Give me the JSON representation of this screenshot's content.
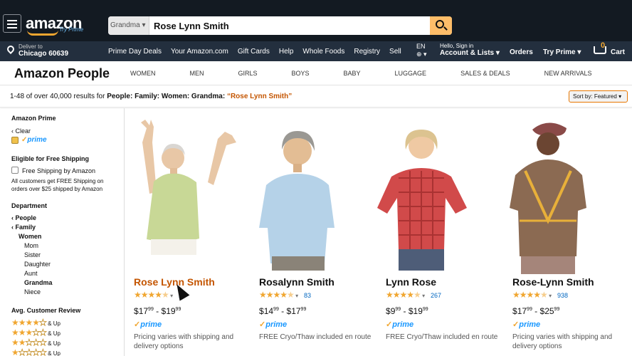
{
  "header": {
    "logo_text": "amazon",
    "logo_subtext": "Try Prime",
    "search_category": "Grandma",
    "search_value": "Rose Lynn Smith",
    "deliver_line1": "Deliver to",
    "deliver_line2": "Chicago 60639",
    "sublinks": [
      "Prime Day Deals",
      "Your Amazon.com",
      "Gift Cards",
      "Help",
      "Whole Foods",
      "Registry",
      "Sell"
    ],
    "lang": "EN",
    "account_line1": "Hello, Sign in",
    "account_line2": "Account & Lists",
    "orders": "Orders",
    "try_prime": "Try Prime",
    "cart_count": "0",
    "cart_label": "Cart"
  },
  "store": {
    "title": "Amazon People",
    "categories": [
      "WOMEN",
      "MEN",
      "GIRLS",
      "BOYS",
      "BABY",
      "LUGGAGE",
      "SALES & DEALS",
      "NEW ARRIVALS"
    ]
  },
  "results": {
    "prefix": "1-48 of over 40,000 results for",
    "path": "People: Family: Women: Grandma:",
    "query": "“Rose Lynn Smith”",
    "sort_label": "Sort by:",
    "sort_value": "Featured"
  },
  "sidebar": {
    "prime_heading": "Amazon Prime",
    "clear": "Clear",
    "prime_text": "prime",
    "shipping_heading": "Eligible for Free Shipping",
    "free_shipping": "Free Shipping by Amazon",
    "shipping_note_1": "All customers get FREE Shipping on",
    "shipping_note_2": "orders over $25 shipped by Amazon",
    "department_heading": "Department",
    "dept_people": "People",
    "dept_family": "Family",
    "dept_women": "Women",
    "dept_children": [
      "Mom",
      "Sister",
      "Daughter",
      "Aunt",
      "Grandma",
      "Niece"
    ],
    "dept_selected": "Grandma",
    "review_heading": "Avg. Customer Review",
    "review_up": "& Up",
    "review_rows": [
      4,
      3,
      2,
      1
    ]
  },
  "products": [
    {
      "title": "Rose Lynn Smith",
      "rating": 4,
      "count": "2",
      "price_low": "17",
      "price_low_cents": "99",
      "price_high": "19",
      "price_high_cents": "99",
      "prime": "prime",
      "note": "Pricing varies with shipping and delivery options"
    },
    {
      "title": "Rosalynn Smith",
      "rating": 4.5,
      "count": "83",
      "price_low": "14",
      "price_low_cents": "99",
      "price_high": "17",
      "price_high_cents": "99",
      "prime": "prime",
      "note": "FREE Cryo/Thaw included en route"
    },
    {
      "title": "Lynn Rose",
      "rating": 4.5,
      "count": "267",
      "price_low": "9",
      "price_low_cents": "99",
      "price_high": "19",
      "price_high_cents": "99",
      "prime": "prime",
      "note": "FREE Cryo/Thaw included en route"
    },
    {
      "title": "Rose-Lynn Smith",
      "rating": 4.5,
      "count": "938",
      "price_low": "17",
      "price_low_cents": "99",
      "price_high": "25",
      "price_high_cents": "99",
      "prime": "prime",
      "note": "Pricing varies with shipping and delivery options"
    }
  ],
  "colors": {
    "nav_dark": "#131a22",
    "nav_sub": "#232f3e",
    "accent_orange": "#f0a630",
    "link_orange": "#c45500",
    "link_blue": "#0066c0",
    "prime_blue": "#1a98ff"
  }
}
